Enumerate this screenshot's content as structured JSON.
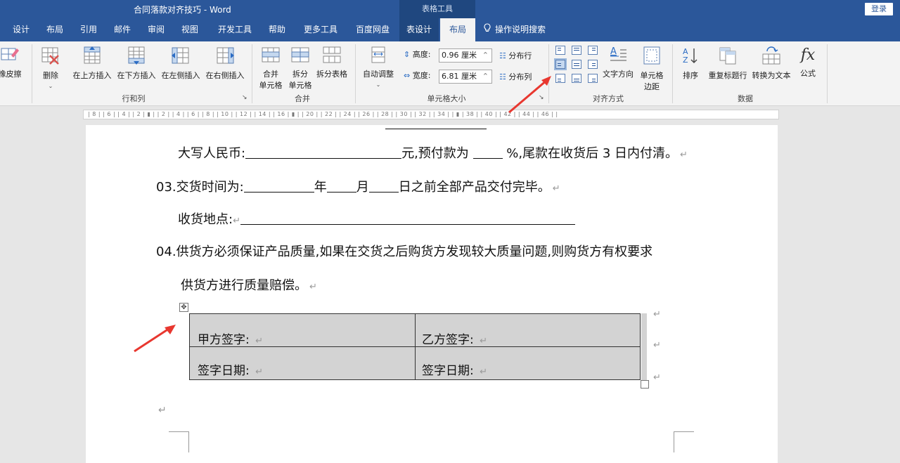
{
  "window": {
    "title": "合同落款对齐技巧  -  Word",
    "context_tools": "表格工具",
    "login_label": "登录"
  },
  "tabs": [
    {
      "label": "设计"
    },
    {
      "label": "布局"
    },
    {
      "label": "引用"
    },
    {
      "label": "邮件"
    },
    {
      "label": "审阅"
    },
    {
      "label": "视图"
    },
    {
      "label": "开发工具"
    },
    {
      "label": "帮助"
    },
    {
      "label": "更多工具"
    },
    {
      "label": "百度网盘"
    },
    {
      "label": "表设计"
    },
    {
      "label": "布局"
    },
    {
      "label": "操作说明搜索"
    }
  ],
  "ribbon": {
    "eraser": "橡皮擦",
    "delete": "删除",
    "insert_above": "在上方插入",
    "insert_below": "在下方插入",
    "insert_left": "在左侧插入",
    "insert_right": "在右侧插入",
    "rows_cols_group": "行和列",
    "merge_cells_1": "合并",
    "merge_cells_2": "单元格",
    "split_cells_1": "拆分",
    "split_cells_2": "单元格",
    "split_table": "拆分表格",
    "merge_group": "合并",
    "autofit": "自动调整",
    "height_label": "高度:",
    "height_value": "0.96 厘米",
    "width_label": "宽度:",
    "width_value": "6.81 厘米",
    "distribute_rows": "分布行",
    "distribute_cols": "分布列",
    "cell_size_group": "单元格大小",
    "text_direction": "文字方向",
    "cell_margins_1": "单元格",
    "cell_margins_2": "边距",
    "alignment_group": "对齐方式",
    "sort": "排序",
    "repeat_header": "重复标题行",
    "convert_text": "转换为文本",
    "formula": "公式",
    "data_group": "数据"
  },
  "ruler": {
    "text": "| 8 |   | 6 |   | 4 |   | 2 |  ▮  |   | 2 |   | 4 |   | 6 |   | 8 |   | 10 |   | 12 |   | 14 |   | 16 |  ▮  |   | 20 |   | 22 |   | 24 |   | 26 |   | 28 |   | 30 |   | 32 |   | 34 |   |  ▮  | 38 |   | 40 |   | 42 |   | 44 |   | 46 |   |"
  },
  "document": {
    "line1_a": "大写人民币:",
    "line1_b": "元,预付款为",
    "line1_c": "%,尾款在收货后 3 日内付清。",
    "line2_a": "03.交货时间为:",
    "line2_b": "年",
    "line2_c": "月",
    "line2_d": "日之前全部产品交付完毕。",
    "line3": "收货地点:",
    "line4": "04.供货方必须保证产品质量,如果在交货之后购货方发现较大质量问题,则购货方有权要求",
    "line5": "供货方进行质量赔偿。",
    "para_mark": "↵"
  },
  "signature_table": {
    "party_a_sign": "甲方签字: ",
    "party_b_sign": "乙方签字: ",
    "date_a": "签字日期: ",
    "date_b": "签字日期: "
  },
  "colors": {
    "title_bar": "#2b579a",
    "context_tab": "#1f477f",
    "annotation_arrow": "#e8372f",
    "table_fill": "#d3d3d3"
  }
}
